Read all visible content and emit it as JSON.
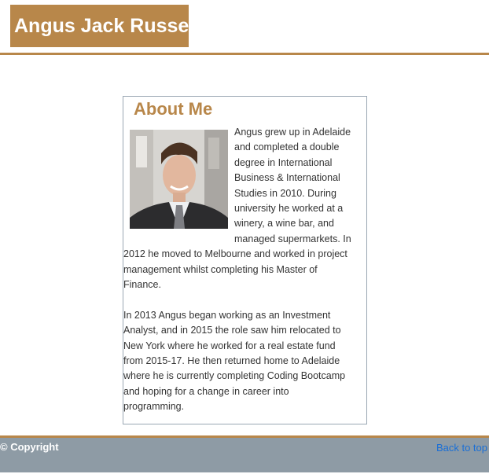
{
  "header": {
    "brand_name": "Angus Jack Russell"
  },
  "about": {
    "heading": "About Me",
    "paragraph_1": "Angus grew up in Adelaide and completed a double degree in International Business & International Studies in 2010. During university he worked at a winery, a wine bar, and managed supermarkets. In 2012 he moved to Melbourne and worked in project management whilst completing his Master of Finance.",
    "paragraph_2": "In 2013 Angus began working as an Investment Analyst, and in 2015 the role saw him relocated to New York where he worked for a real estate fund from 2015-17. He then returned home to Adelaide where he is currently completing Coding Bootcamp and hoping for a change in career into programming."
  },
  "footer": {
    "copyright": "© Copyright",
    "back_to_top": "Back to top"
  },
  "colors": {
    "accent": "#b8874a",
    "footer_bg": "#8e9ba5",
    "link": "#1a6fd6"
  }
}
